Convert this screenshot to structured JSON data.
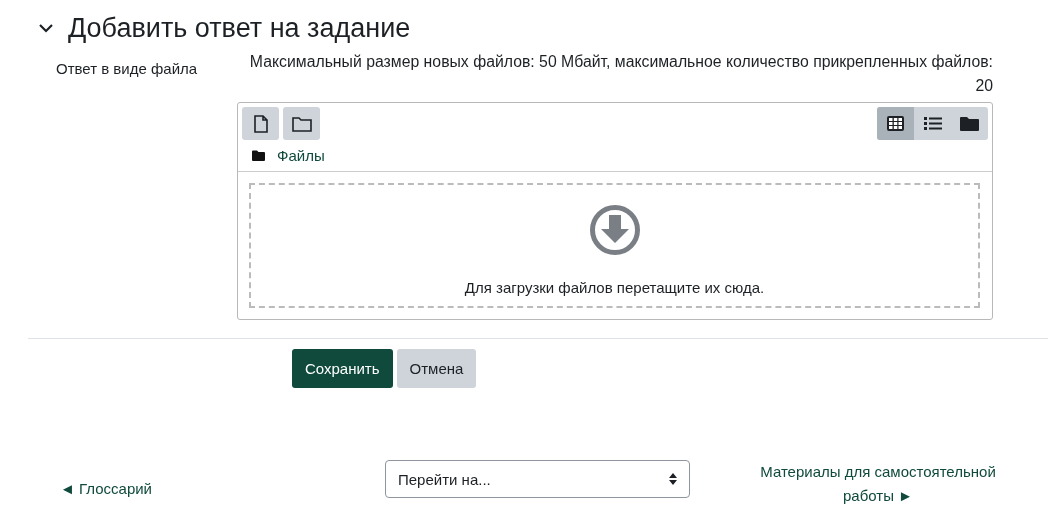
{
  "section": {
    "title": "Добавить ответ на задание",
    "expanded": true
  },
  "field": {
    "label": "Ответ в виде файла",
    "limits": "Максимальный размер новых файлов: 50 Мбайт, максимальное количество прикрепленных файлов: 20"
  },
  "filepicker": {
    "view_modes": [
      {
        "kind": "grid",
        "selected": true
      },
      {
        "kind": "list",
        "selected": false
      },
      {
        "kind": "tree",
        "selected": false
      }
    ],
    "path": "Файлы",
    "dropzone": "Для загрузки файлов перетащите их сюда."
  },
  "buttons": [
    {
      "label": "Сохранить",
      "kind": "primary"
    },
    {
      "label": "Отмена",
      "kind": "secondary"
    }
  ],
  "navigation": {
    "previous": "◄ Глоссарий",
    "jump": {
      "placeholder": "Перейти на..."
    },
    "next": "Материалы для самостоятельной работы ►"
  }
}
